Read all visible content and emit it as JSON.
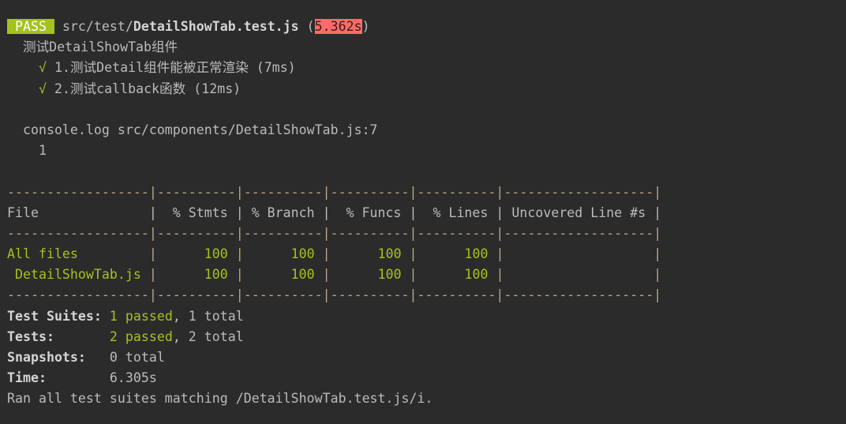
{
  "colors": {
    "background": "#2b2b2b",
    "text": "#bbbbbb",
    "pass": "#a4c21f",
    "slow": "#ff6b68"
  },
  "lines": [
    [
      {
        "t": " PASS ",
        "c": "badge",
        "n": "pass-badge"
      },
      {
        "t": " src/test/"
      },
      {
        "t": "DetailShowTab.test.js",
        "c": "bold",
        "n": "test-file-name"
      },
      {
        "t": " ("
      },
      {
        "t": "5.362s",
        "c": "time",
        "n": "test-duration"
      },
      {
        "t": ")"
      }
    ],
    [
      {
        "t": "  测试DetailShowTab组件",
        "n": "describe-title"
      }
    ],
    [
      {
        "t": "    "
      },
      {
        "t": "√",
        "c": "green",
        "n": "check-icon"
      },
      {
        "t": " 1.测试Detail组件能被正常渲染 (7ms)",
        "n": "test-case"
      }
    ],
    [
      {
        "t": "    "
      },
      {
        "t": "√",
        "c": "green",
        "n": "check-icon"
      },
      {
        "t": " 2.测试callback函数 (12ms)",
        "n": "test-case"
      }
    ],
    [],
    [
      {
        "t": "  console.log src/components/DetailShowTab.js:7",
        "n": "console-log-source"
      }
    ],
    [
      {
        "t": "    1",
        "n": "console-log-output"
      }
    ],
    [],
    [
      {
        "t": "------------------|----------|----------|----------|----------|-------------------|",
        "c": "pipe",
        "n": "table-separator"
      }
    ],
    [
      {
        "t": "File              |  % Stmts | % Branch |  % Funcs |  % Lines | Uncovered Line #s |",
        "n": "coverage-header"
      }
    ],
    [
      {
        "t": "------------------|----------|----------|----------|----------|-------------------|",
        "c": "pipe",
        "n": "table-separator"
      }
    ],
    [
      {
        "t": "All files         ",
        "c": "green",
        "n": "row-file"
      },
      {
        "t": "|",
        "c": "pipe"
      },
      {
        "t": "      100 ",
        "c": "green",
        "n": "row-stmts"
      },
      {
        "t": "|",
        "c": "pipe"
      },
      {
        "t": "      100 ",
        "c": "green",
        "n": "row-branch"
      },
      {
        "t": "|",
        "c": "pipe"
      },
      {
        "t": "      100 ",
        "c": "green",
        "n": "row-funcs"
      },
      {
        "t": "|",
        "c": "pipe"
      },
      {
        "t": "      100 ",
        "c": "green",
        "n": "row-lines"
      },
      {
        "t": "|",
        "c": "pipe"
      },
      {
        "t": "                   "
      },
      {
        "t": "|",
        "c": "pipe"
      }
    ],
    [
      {
        "t": " DetailShowTab.js ",
        "c": "green",
        "n": "row-file"
      },
      {
        "t": "|",
        "c": "pipe"
      },
      {
        "t": "      100 ",
        "c": "green",
        "n": "row-stmts"
      },
      {
        "t": "|",
        "c": "pipe"
      },
      {
        "t": "      100 ",
        "c": "green",
        "n": "row-branch"
      },
      {
        "t": "|",
        "c": "pipe"
      },
      {
        "t": "      100 ",
        "c": "green",
        "n": "row-funcs"
      },
      {
        "t": "|",
        "c": "pipe"
      },
      {
        "t": "      100 ",
        "c": "green",
        "n": "row-lines"
      },
      {
        "t": "|",
        "c": "pipe"
      },
      {
        "t": "                   "
      },
      {
        "t": "|",
        "c": "pipe"
      }
    ],
    [
      {
        "t": "------------------|----------|----------|----------|----------|-------------------|",
        "c": "pipe",
        "n": "table-separator"
      }
    ],
    [
      {
        "t": "Test Suites:",
        "c": "bold",
        "n": "summary-label"
      },
      {
        "t": " "
      },
      {
        "t": "1 passed",
        "c": "green",
        "n": "suites-passed"
      },
      {
        "t": ", 1 total"
      }
    ],
    [
      {
        "t": "Tests:",
        "c": "bold",
        "n": "summary-label"
      },
      {
        "t": "       "
      },
      {
        "t": "2 passed",
        "c": "green",
        "n": "tests-passed"
      },
      {
        "t": ", 2 total"
      }
    ],
    [
      {
        "t": "Snapshots:",
        "c": "bold",
        "n": "summary-label"
      },
      {
        "t": "   0 total"
      }
    ],
    [
      {
        "t": "Time:",
        "c": "bold",
        "n": "summary-label"
      },
      {
        "t": "        6.305s"
      }
    ],
    [
      {
        "t": "Ran all test suites matching /DetailShowTab.test.js/i.",
        "n": "run-summary"
      }
    ]
  ]
}
